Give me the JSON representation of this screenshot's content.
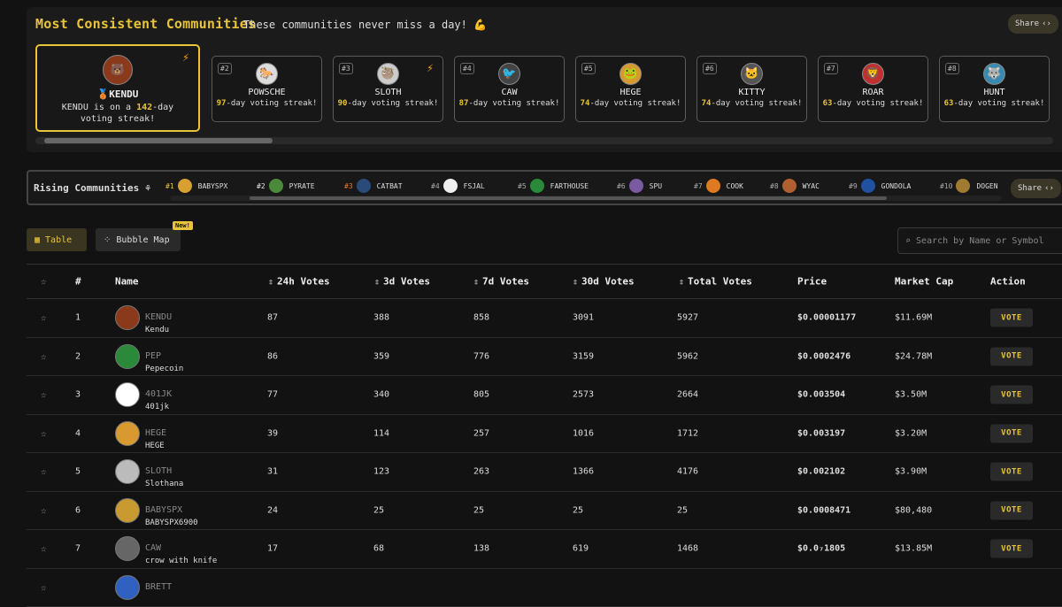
{
  "consistent": {
    "title": "Most Consistent Communities",
    "subtitle": "These communities never miss a day! 💪",
    "share_label": "Share",
    "first": {
      "medal": "🥉",
      "name": "KENDU",
      "streak_prefix": "KENDU is on a ",
      "days": "142",
      "streak_suffix": "-day voting streak!"
    },
    "cards": [
      {
        "rank": "#2",
        "name": "POWSCHE",
        "days": "97",
        "suffix": "-day voting streak!",
        "bolt": false
      },
      {
        "rank": "#3",
        "name": "SLOTH",
        "days": "90",
        "suffix": "-day voting streak!",
        "bolt": true
      },
      {
        "rank": "#4",
        "name": "CAW",
        "days": "87",
        "suffix": "-day voting streak!",
        "bolt": false
      },
      {
        "rank": "#5",
        "name": "HEGE",
        "days": "74",
        "suffix": "-day voting streak!",
        "bolt": false
      },
      {
        "rank": "#6",
        "name": "KITTY",
        "days": "74",
        "suffix": "-day voting streak!",
        "bolt": false
      },
      {
        "rank": "#7",
        "name": "ROAR",
        "days": "63",
        "suffix": "-day voting streak!",
        "bolt": false
      },
      {
        "rank": "#8",
        "name": "HUNT",
        "days": "63",
        "suffix": "-day voting streak!",
        "bolt": false
      }
    ]
  },
  "rising": {
    "label": "Rising Communities",
    "share_label": "Share",
    "items": [
      {
        "rank": "#1",
        "name": "BABYSPX",
        "color": "#e8c43a"
      },
      {
        "rank": "#2",
        "name": "PYRATE",
        "color": "#e6e6e6"
      },
      {
        "rank": "#3",
        "name": "CATBAT",
        "color": "#f07a2a"
      },
      {
        "rank": "#4",
        "name": "FSJAL",
        "color": "#aaaaaa"
      },
      {
        "rank": "#5",
        "name": "FARTHOUSE",
        "color": "#aaaaaa"
      },
      {
        "rank": "#6",
        "name": "SPU",
        "color": "#aaaaaa"
      },
      {
        "rank": "#7",
        "name": "COOK",
        "color": "#aaaaaa"
      },
      {
        "rank": "#8",
        "name": "WYAC",
        "color": "#aaaaaa"
      },
      {
        "rank": "#9",
        "name": "GONDOLA",
        "color": "#aaaaaa"
      },
      {
        "rank": "#10",
        "name": "DOGEN",
        "color": "#aaaaaa"
      }
    ]
  },
  "tabs": {
    "table": "Table",
    "bubble": "Bubble Map",
    "new_badge": "New!"
  },
  "search": {
    "placeholder": "Search by Name or Symbol"
  },
  "table": {
    "headers": {
      "num": "#",
      "name": "Name",
      "v24": "24h Votes",
      "v3d": "3d Votes",
      "v7d": "7d Votes",
      "v30d": "30d Votes",
      "total": "Total Votes",
      "price": "Price",
      "mcap": "Market Cap",
      "action": "Action"
    },
    "vote_label": "VOTE",
    "rows": [
      {
        "num": "1",
        "ticker": "KENDU",
        "name": "Kendu",
        "v24": "87",
        "v3d": "388",
        "v7d": "858",
        "v30d": "3091",
        "total": "5927",
        "price": "$0.00001177",
        "mcap": "$11.69M"
      },
      {
        "num": "2",
        "ticker": "PEP",
        "name": "Pepecoin",
        "v24": "86",
        "v3d": "359",
        "v7d": "776",
        "v30d": "3159",
        "total": "5962",
        "price": "$0.0002476",
        "mcap": "$24.78M"
      },
      {
        "num": "3",
        "ticker": "401JK",
        "name": "401jk",
        "v24": "77",
        "v3d": "340",
        "v7d": "805",
        "v30d": "2573",
        "total": "2664",
        "price": "$0.003504",
        "mcap": "$3.50M"
      },
      {
        "num": "4",
        "ticker": "HEGE",
        "name": "HEGE",
        "v24": "39",
        "v3d": "114",
        "v7d": "257",
        "v30d": "1016",
        "total": "1712",
        "price": "$0.003197",
        "mcap": "$3.20M"
      },
      {
        "num": "5",
        "ticker": "SLOTH",
        "name": "Slothana",
        "v24": "31",
        "v3d": "123",
        "v7d": "263",
        "v30d": "1366",
        "total": "4176",
        "price": "$0.002102",
        "mcap": "$3.90M"
      },
      {
        "num": "6",
        "ticker": "BABYSPX",
        "name": "BABYSPX6900",
        "v24": "24",
        "v3d": "25",
        "v7d": "25",
        "v30d": "25",
        "total": "25",
        "price": "$0.0008471",
        "mcap": "$80,480"
      },
      {
        "num": "7",
        "ticker": "CAW",
        "name": "crow with knife",
        "v24": "17",
        "v3d": "68",
        "v7d": "138",
        "v30d": "619",
        "total": "1468",
        "price": "$0.0₇1805",
        "mcap": "$13.85M"
      },
      {
        "num": "",
        "ticker": "BRETT",
        "name": "",
        "v24": "",
        "v3d": "",
        "v7d": "",
        "v30d": "",
        "total": "",
        "price": "",
        "mcap": ""
      }
    ]
  }
}
